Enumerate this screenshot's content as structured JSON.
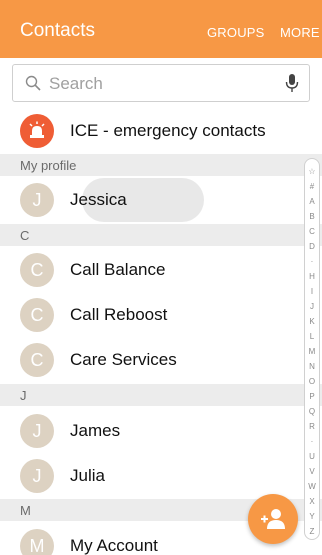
{
  "appbar": {
    "title": "Contacts",
    "groups": "GROUPS",
    "more": "MORE"
  },
  "search": {
    "placeholder": "Search"
  },
  "ice": {
    "label": "ICE - emergency contacts"
  },
  "sections": {
    "my_profile": "My profile",
    "c": "C",
    "j": "J",
    "m": "M"
  },
  "contacts": {
    "jessica": {
      "initial": "J",
      "name": "Jessica"
    },
    "call_balance": {
      "initial": "C",
      "name": "Call Balance"
    },
    "call_reboost": {
      "initial": "C",
      "name": "Call Reboost"
    },
    "care_services": {
      "initial": "C",
      "name": "Care Services"
    },
    "james": {
      "initial": "J",
      "name": "James"
    },
    "julia": {
      "initial": "J",
      "name": "Julia"
    },
    "my_account": {
      "initial": "M",
      "name": "My Account"
    }
  },
  "index": [
    "☆",
    "#",
    "A",
    "B",
    "C",
    "D",
    "·",
    "H",
    "I",
    "J",
    "K",
    "L",
    "M",
    "N",
    "O",
    "P",
    "Q",
    "R",
    "·",
    "U",
    "V",
    "W",
    "X",
    "Y",
    "Z"
  ],
  "colors": {
    "accent": "#f79845",
    "ice": "#ef5d35",
    "avatar": "#ddd2c2"
  },
  "icons": {
    "search": "search-icon",
    "mic": "microphone-icon",
    "ice": "siren-icon",
    "fab": "add-contact-icon"
  }
}
